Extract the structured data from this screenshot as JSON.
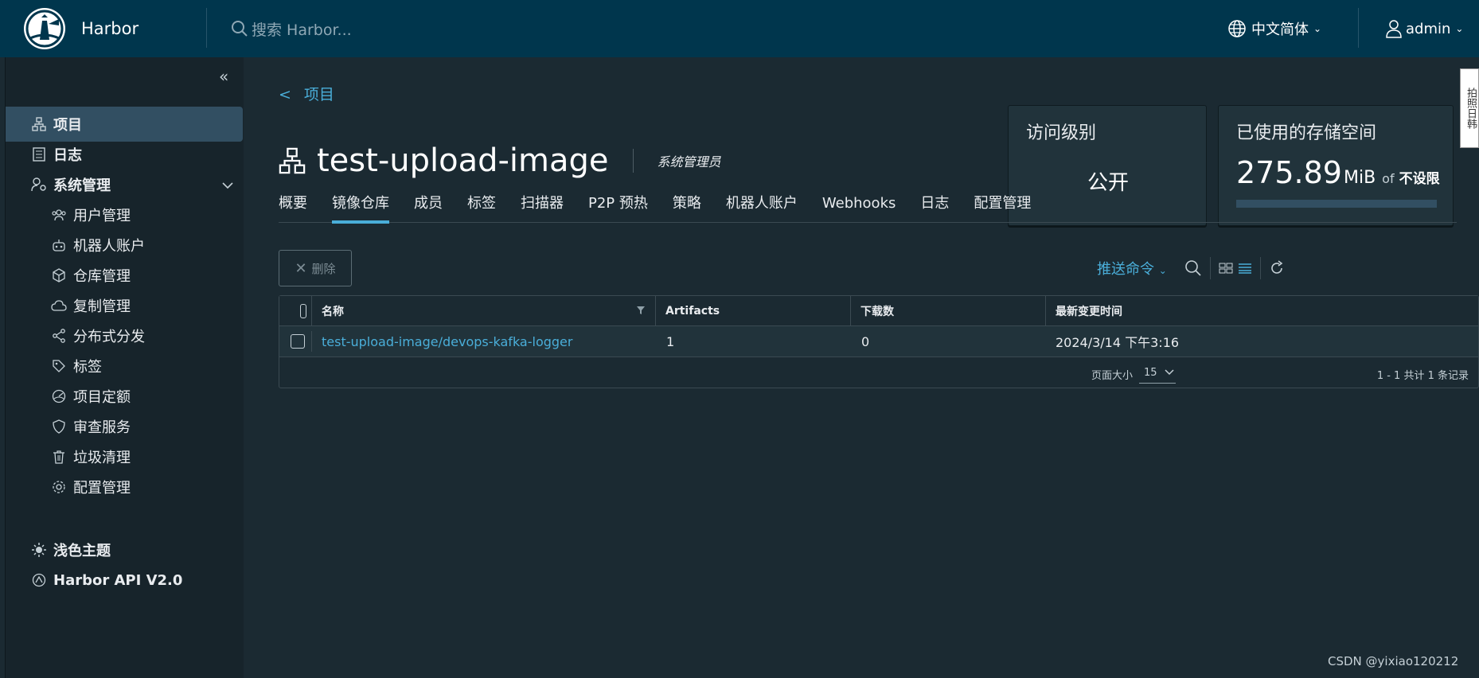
{
  "header": {
    "app_name": "Harbor",
    "search_placeholder": "搜索 Harbor...",
    "language": "中文简体",
    "user": "admin"
  },
  "sidebar": {
    "items": [
      {
        "label": "项目",
        "icon": "projects-icon"
      },
      {
        "label": "日志",
        "icon": "logs-icon"
      },
      {
        "label": "系统管理",
        "icon": "admin-icon"
      },
      {
        "label": "用户管理",
        "icon": "users-icon"
      },
      {
        "label": "机器人账户",
        "icon": "robot-icon"
      },
      {
        "label": "仓库管理",
        "icon": "registry-icon"
      },
      {
        "label": "复制管理",
        "icon": "replication-icon"
      },
      {
        "label": "分布式分发",
        "icon": "share-icon"
      },
      {
        "label": "标签",
        "icon": "tag-icon"
      },
      {
        "label": "项目定额",
        "icon": "quota-icon"
      },
      {
        "label": "审查服务",
        "icon": "shield-icon"
      },
      {
        "label": "垃圾清理",
        "icon": "trash-icon"
      },
      {
        "label": "配置管理",
        "icon": "gear-icon"
      }
    ],
    "theme_label": "浅色主题",
    "api_label": "Harbor API V2.0"
  },
  "main": {
    "back_label": "项目",
    "project_name": "test-upload-image",
    "role": "系统管理员",
    "access_card": {
      "label": "访问级别",
      "value": "公开"
    },
    "storage_card": {
      "label": "已使用的存储空间",
      "value": "275.89",
      "unit": "MiB",
      "of": "of",
      "limit": "不设限"
    },
    "tabs": [
      "概要",
      "镜像仓库",
      "成员",
      "标签",
      "扫描器",
      "P2P 预热",
      "策略",
      "机器人账户",
      "Webhooks",
      "日志",
      "配置管理"
    ],
    "active_tab": "镜像仓库",
    "delete_label": "删除",
    "push_command_label": "推送命令",
    "table": {
      "columns": [
        "名称",
        "Artifacts",
        "下载数",
        "最新变更时间"
      ],
      "rows": [
        {
          "name": "test-upload-image/devops-kafka-logger",
          "artifacts": "1",
          "downloads": "0",
          "updated": "2024/3/14 下午3:16"
        }
      ],
      "page_size_label": "页面大小",
      "page_size": "15",
      "pagination_info": "1 - 1 共计 1 条记录"
    }
  },
  "edge_widget": "拍照日韩",
  "watermark": "CSDN @yixiao120212"
}
